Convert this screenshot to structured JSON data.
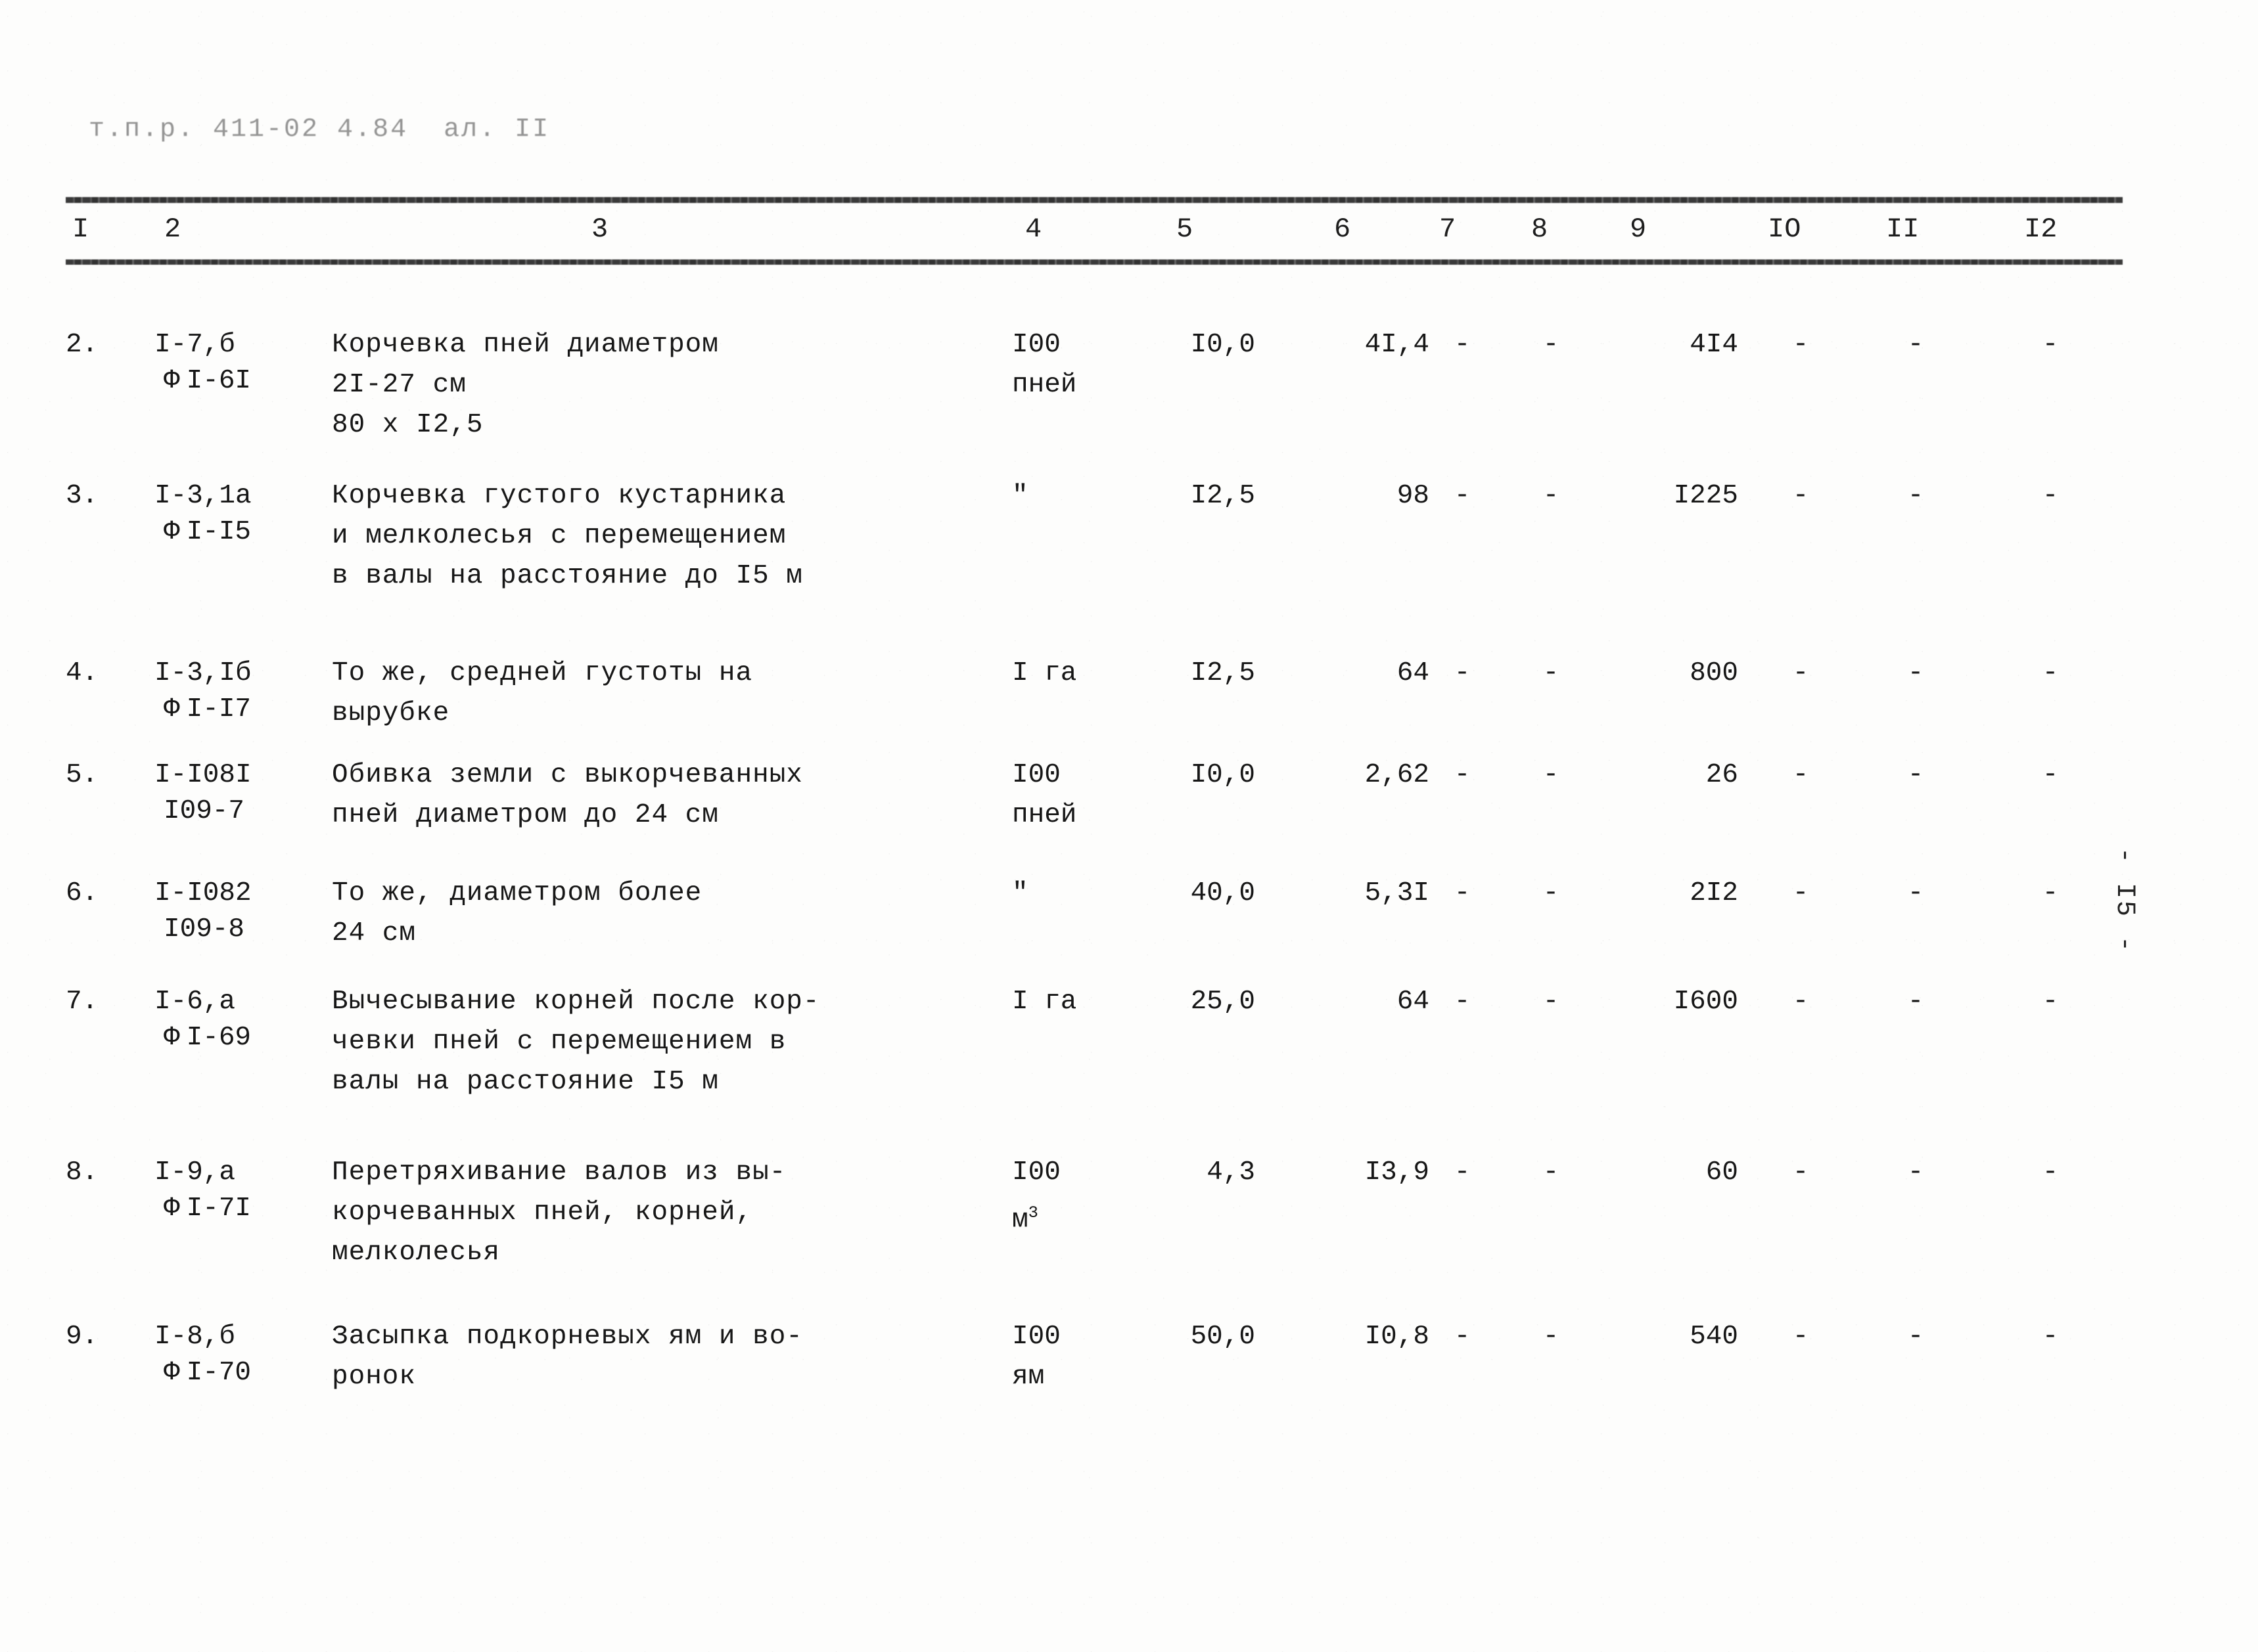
{
  "document": {
    "header_code": "т.п.р. 411-02 4.84  ал. II",
    "page_marker": "- I5 -"
  },
  "table": {
    "column_numbers": [
      "I",
      "2",
      "3",
      "4",
      "5",
      "6",
      "7",
      "8",
      "9",
      "IO",
      "II",
      "I2"
    ],
    "rows": [
      {
        "no": "2.",
        "code_main": "I-7,б",
        "code_mark": "Ф",
        "code_alt": "I-6I",
        "description_lines": [
          "Корчевка пней диаметром",
          "2I-27 см",
          "80 х I2,5"
        ],
        "unit_lines": [
          "I00",
          "пней"
        ],
        "qty": "I0,0",
        "c6": "4I,4",
        "c7": "-",
        "c8": "-",
        "c9": "4I4",
        "c10": "-",
        "c11": "-",
        "c12": "-"
      },
      {
        "no": "3.",
        "code_main": "I-3,1а",
        "code_mark": "Ф",
        "code_alt": "I-I5",
        "description_lines": [
          "Корчевка густого кустарника",
          "и мелколесья с перемещением",
          "в валы на расстояние до I5 м"
        ],
        "unit_lines": [
          "\""
        ],
        "qty": "I2,5",
        "c6": "98",
        "c7": "-",
        "c8": "-",
        "c9": "I225",
        "c10": "-",
        "c11": "-",
        "c12": "-"
      },
      {
        "no": "4.",
        "code_main": "I-3,Iб",
        "code_mark": "Ф",
        "code_alt": "I-I7",
        "description_lines": [
          "То же, средней густоты на",
          "вырубке"
        ],
        "unit_lines": [
          "I га"
        ],
        "qty": "I2,5",
        "c6": "64",
        "c7": "-",
        "c8": "-",
        "c9": "800",
        "c10": "-",
        "c11": "-",
        "c12": "-"
      },
      {
        "no": "5.",
        "code_main": "I-I08I",
        "code_mark": "",
        "code_alt": "I09-7",
        "description_lines": [
          "Обивка земли с выкорчеванных",
          "пней диаметром до 24 см"
        ],
        "unit_lines": [
          "I00",
          "пней"
        ],
        "qty": "I0,0",
        "c6": "2,62",
        "c7": "-",
        "c8": "-",
        "c9": "26",
        "c10": "-",
        "c11": "-",
        "c12": "-"
      },
      {
        "no": "6.",
        "code_main": "I-I082",
        "code_mark": "",
        "code_alt": "I09-8",
        "description_lines": [
          "То же, диаметром более",
          "24 см"
        ],
        "unit_lines": [
          "\""
        ],
        "qty": "40,0",
        "c6": "5,3I",
        "c7": "-",
        "c8": "-",
        "c9": "2I2",
        "c10": "-",
        "c11": "-",
        "c12": "-"
      },
      {
        "no": "7.",
        "code_main": "I-6,а",
        "code_mark": "Ф",
        "code_alt": "I-69",
        "description_lines": [
          "Вычесывание корней после кор-",
          "чевки пней с перемещением в",
          "валы на расстояние I5 м"
        ],
        "unit_lines": [
          "I га"
        ],
        "qty": "25,0",
        "c6": "64",
        "c7": "-",
        "c8": "-",
        "c9": "I600",
        "c10": "-",
        "c11": "-",
        "c12": "-"
      },
      {
        "no": "8.",
        "code_main": "I-9,а",
        "code_mark": "Ф",
        "code_alt": "I-7I",
        "description_lines": [
          "Перетряхивание валов из вы-",
          "корчеванных пней, корней,",
          "мелколесья"
        ],
        "unit_lines": [
          "I00",
          "м3"
        ],
        "qty": "4,3",
        "c6": "I3,9",
        "c7": "-",
        "c8": "-",
        "c9": "60",
        "c10": "-",
        "c11": "-",
        "c12": "-"
      },
      {
        "no": "9.",
        "code_main": "I-8,б",
        "code_mark": "Ф",
        "code_alt": "I-70",
        "description_lines": [
          "Засыпка подкорневых ям и во-",
          "ронок"
        ],
        "unit_lines": [
          "I00",
          "ям"
        ],
        "qty": "50,0",
        "c6": "I0,8",
        "c7": "-",
        "c8": "-",
        "c9": "540",
        "c10": "-",
        "c11": "-",
        "c12": "-"
      }
    ]
  }
}
